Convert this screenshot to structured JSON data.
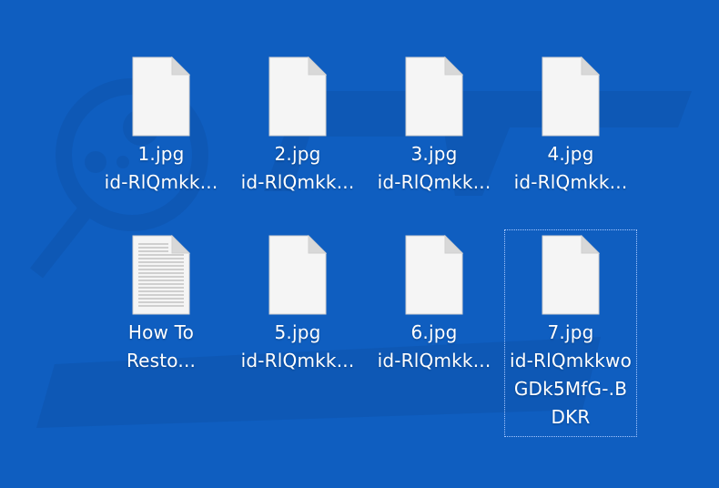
{
  "colors": {
    "desktop_bg": "#0f5ec0",
    "file_page": "#f5f5f5",
    "file_fold": "#d8d8d8",
    "text": "#ffffff"
  },
  "files": [
    {
      "icon": "blank-file-icon",
      "name_line1": "1.jpg",
      "name_line2": "id-RlQmkk..."
    },
    {
      "icon": "blank-file-icon",
      "name_line1": "2.jpg",
      "name_line2": "id-RlQmkk..."
    },
    {
      "icon": "blank-file-icon",
      "name_line1": "3.jpg",
      "name_line2": "id-RlQmkk..."
    },
    {
      "icon": "blank-file-icon",
      "name_line1": "4.jpg",
      "name_line2": "id-RlQmkk..."
    },
    {
      "icon": "text-document-icon",
      "name_line1": "How To",
      "name_line2": "Resto..."
    },
    {
      "icon": "blank-file-icon",
      "name_line1": "5.jpg",
      "name_line2": "id-RlQmkk..."
    },
    {
      "icon": "blank-file-icon",
      "name_line1": "6.jpg",
      "name_line2": "id-RlQmkk..."
    },
    {
      "icon": "blank-file-icon",
      "name_line1": "7.jpg",
      "name_line2": "id-RlQmkkwo",
      "name_line3": "GDk5MfG-.B",
      "name_line4": "DKR",
      "selected": true
    }
  ]
}
